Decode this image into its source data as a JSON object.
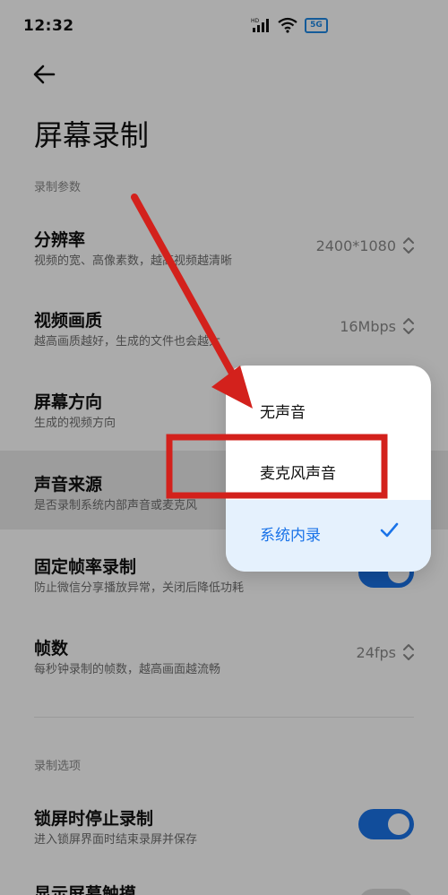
{
  "status": {
    "time": "12:32",
    "battery_label": "5G",
    "network_label": "HD"
  },
  "page": {
    "title": "屏幕录制"
  },
  "sections": {
    "params": "录制参数",
    "options": "录制选项"
  },
  "rows": {
    "resolution": {
      "title": "分辨率",
      "subtitle": "视频的宽、高像素数，越高视频越清晰",
      "value": "2400*1080"
    },
    "quality": {
      "title": "视频画质",
      "subtitle": "越高画质越好，生成的文件也会越大",
      "value": "16Mbps"
    },
    "orientation": {
      "title": "屏幕方向",
      "subtitle": "生成的视频方向"
    },
    "audio": {
      "title": "声音来源",
      "subtitle": "是否录制系统内部声音或麦克风"
    },
    "fixed_fps": {
      "title": "固定帧率录制",
      "subtitle": "防止微信分享播放异常，关闭后降低功耗",
      "enabled": true
    },
    "fps": {
      "title": "帧数",
      "subtitle": "每秒钟录制的帧数，越高画面越流畅",
      "value": "24fps"
    },
    "lock_stop": {
      "title": "锁屏时停止录制",
      "subtitle": "进入锁屏界面时结束录屏并保存",
      "enabled": true
    },
    "show_touch": {
      "title": "显示屏幕触摸"
    }
  },
  "dropdown": {
    "options": [
      {
        "label": "无声音",
        "selected": false
      },
      {
        "label": "麦克风声音",
        "selected": false
      },
      {
        "label": "系统内录",
        "selected": true
      }
    ]
  },
  "colors": {
    "accent": "#1a73e8",
    "annotation": "#d3211c",
    "overlay": "rgba(0,0,0,0.33)"
  },
  "icons": [
    "back-arrow-icon",
    "signal-icon",
    "wifi-icon",
    "battery-icon",
    "stepper-icon",
    "check-icon"
  ]
}
